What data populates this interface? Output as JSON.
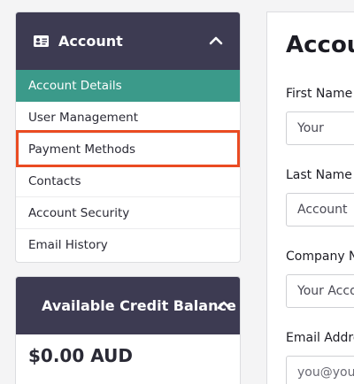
{
  "account_panel": {
    "title": "Account",
    "items": [
      {
        "label": "Account Details",
        "active": true
      },
      {
        "label": "User Management",
        "active": false
      },
      {
        "label": "Payment Methods",
        "active": false,
        "highlighted": true
      },
      {
        "label": "Contacts",
        "active": false
      },
      {
        "label": "Account Security",
        "active": false
      },
      {
        "label": "Email History",
        "active": false
      }
    ]
  },
  "credit_panel": {
    "title": "Available Credit Balance",
    "amount": "$0.00 AUD"
  },
  "form": {
    "title": "Accou",
    "fields": [
      {
        "label": "First Name",
        "value": "Your"
      },
      {
        "label": "Last Name",
        "value": "Account"
      },
      {
        "label": "Company N",
        "value": "Your Acco"
      },
      {
        "label": "Email Addre",
        "value": "you@your"
      }
    ]
  },
  "colors": {
    "header_bg": "#3d3b52",
    "active_item_bg": "#3b9a8a",
    "highlight_border": "#ea4b22"
  },
  "icons": {
    "account_icon": "id-card-icon",
    "collapse_icon": "chevron-up-icon"
  }
}
